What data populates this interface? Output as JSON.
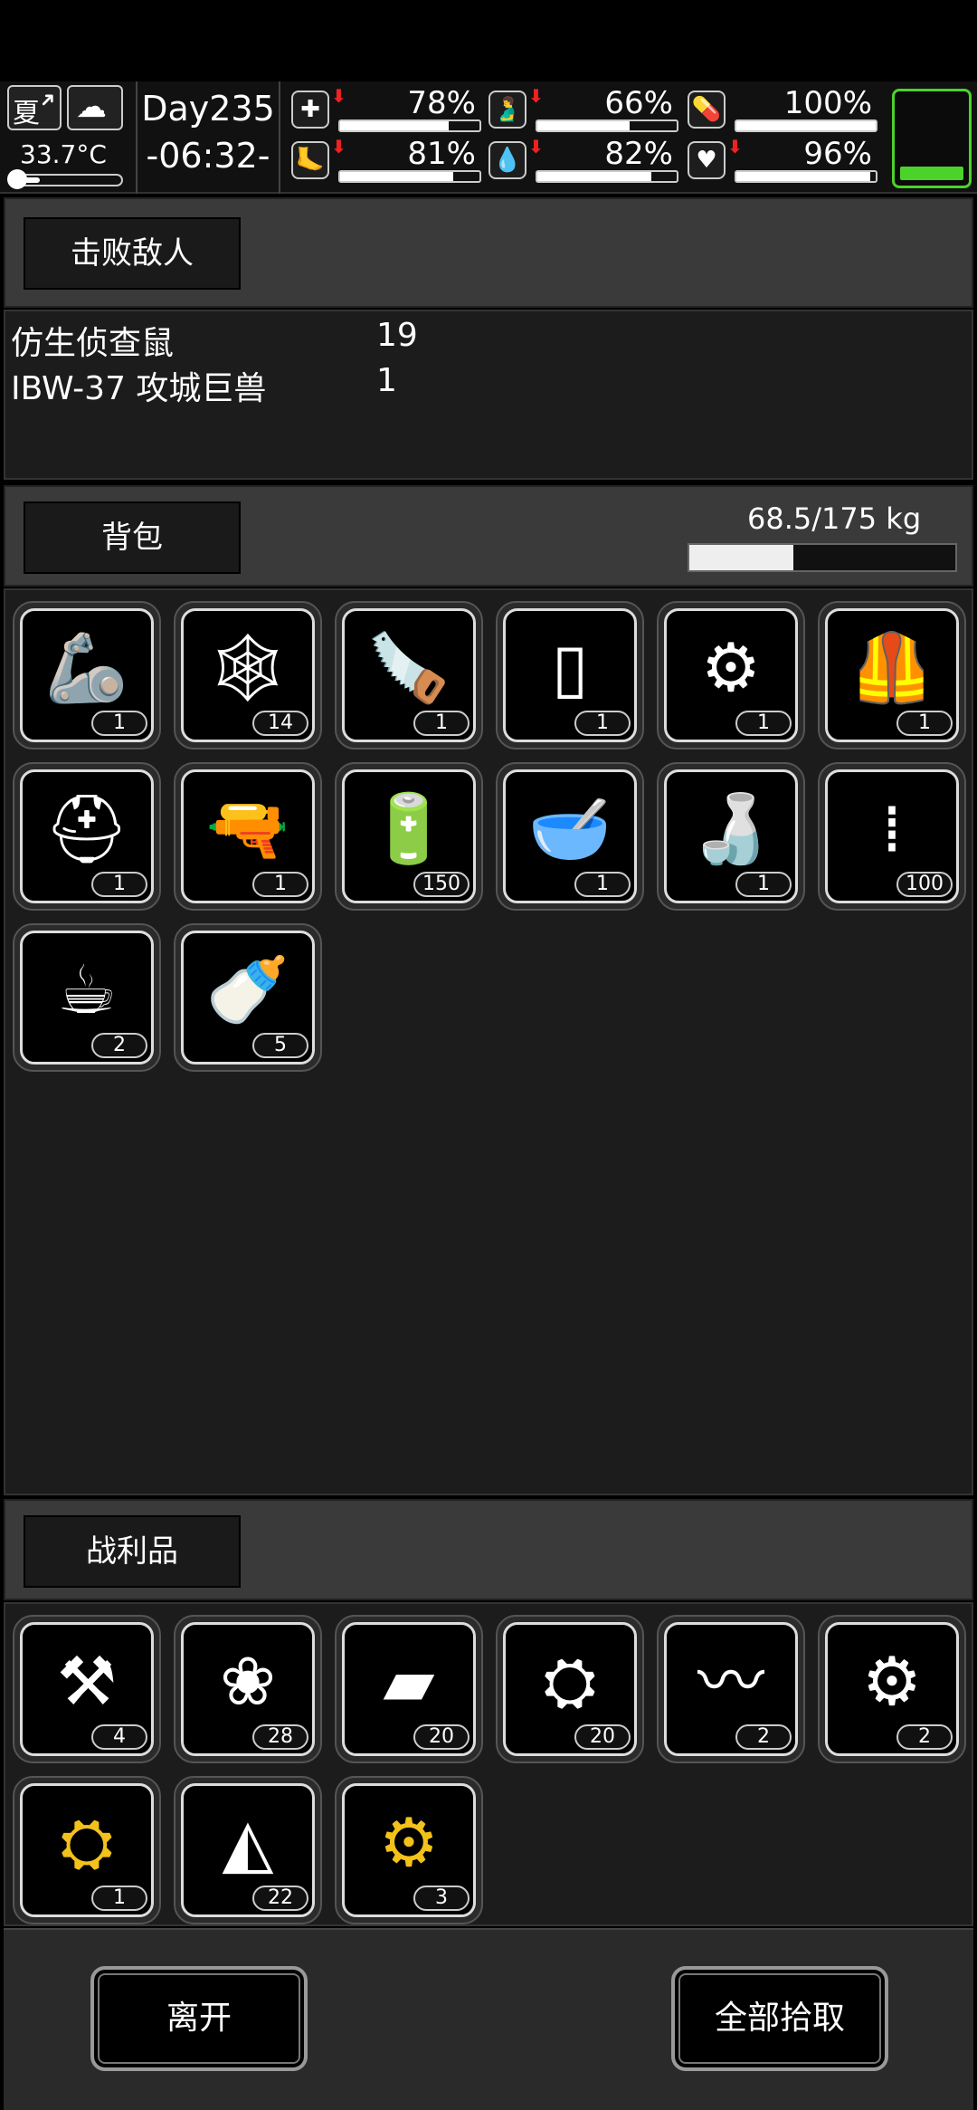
{
  "status": {
    "season": "夏",
    "season_arrow_icon": "up-right-arrow",
    "weather_icon": "rain-cloud",
    "temperature": "33.7°C",
    "day": "Day235",
    "time": "-06:32-",
    "stats": [
      {
        "icon": "medkit-icon",
        "glyph": "✚",
        "percent": "78%",
        "value": 0.78,
        "trend": "down"
      },
      {
        "icon": "stomach-icon",
        "glyph": "🫃",
        "percent": "66%",
        "value": 0.66,
        "trend": "down"
      },
      {
        "icon": "pill-icon",
        "glyph": "💊",
        "percent": "100%",
        "value": 1.0,
        "trend": "none"
      },
      {
        "icon": "foot-icon",
        "glyph": "🦶",
        "percent": "81%",
        "value": 0.81,
        "trend": "down"
      },
      {
        "icon": "water-drop-icon",
        "glyph": "💧",
        "percent": "82%",
        "value": 0.82,
        "trend": "down"
      },
      {
        "icon": "heart-icon",
        "glyph": "♥",
        "percent": "96%",
        "value": 0.96,
        "trend": "down"
      }
    ],
    "battery_level": 0.15,
    "accent_green": "#4bd32a"
  },
  "defeated": {
    "title": "击败敌人",
    "enemies": [
      {
        "name": "仿生侦查鼠",
        "count": "19"
      },
      {
        "name": "IBW-37 攻城巨兽",
        "count": "1"
      }
    ]
  },
  "backpack": {
    "title": "背包",
    "weight": "68.5/175 kg",
    "weight_fraction": 0.39,
    "items": [
      {
        "icon": "robotic-arm-icon",
        "glyph": "🦾",
        "color": "white",
        "count": "1"
      },
      {
        "icon": "net-icon",
        "glyph": "🕸",
        "color": "white",
        "count": "14"
      },
      {
        "icon": "chainsaw-weapon-icon",
        "glyph": "🪚",
        "color": "orange",
        "count": "1"
      },
      {
        "icon": "canister-icon",
        "glyph": "▯",
        "color": "white",
        "count": "1"
      },
      {
        "icon": "scrap-parts-icon",
        "glyph": "⚙",
        "color": "white",
        "count": "1"
      },
      {
        "icon": "armor-vest-icon",
        "glyph": "🦺",
        "color": "white",
        "count": "1"
      },
      {
        "icon": "helmet-icon",
        "glyph": "⛑",
        "color": "white",
        "count": "1"
      },
      {
        "icon": "minigun-icon",
        "glyph": "🔫",
        "color": "blue",
        "count": "1"
      },
      {
        "icon": "battery-icon",
        "glyph": "🔋",
        "color": "white",
        "count": "150"
      },
      {
        "icon": "food-bowl-icon",
        "glyph": "🥣",
        "color": "white",
        "count": "1"
      },
      {
        "icon": "water-bottle-icon",
        "glyph": "🍶",
        "color": "white",
        "count": "1"
      },
      {
        "icon": "bullets-icon",
        "glyph": "⁞",
        "color": "white",
        "count": "100"
      },
      {
        "icon": "coffee-cup-icon",
        "glyph": "☕",
        "color": "white",
        "count": "2"
      },
      {
        "icon": "milk-bottle-icon",
        "glyph": "🍼",
        "color": "white",
        "count": "5"
      }
    ]
  },
  "loot": {
    "title": "战利品",
    "items": [
      {
        "icon": "metal-scrap-icon",
        "glyph": "⚒",
        "color": "white",
        "count": "4"
      },
      {
        "icon": "cotton-balls-icon",
        "glyph": "❀",
        "color": "white",
        "count": "28"
      },
      {
        "icon": "metal-plate-icon",
        "glyph": "▰",
        "color": "white",
        "count": "20"
      },
      {
        "icon": "mechanical-parts-icon",
        "glyph": "⛭",
        "color": "white",
        "count": "20"
      },
      {
        "icon": "wires-icon",
        "glyph": "〰",
        "color": "white",
        "count": "2"
      },
      {
        "icon": "gears-icon",
        "glyph": "⚙",
        "color": "white",
        "count": "2"
      },
      {
        "icon": "gold-mechanical-parts-icon",
        "glyph": "⛭",
        "color": "gold",
        "count": "1"
      },
      {
        "icon": "cloth-icon",
        "glyph": "◭",
        "color": "white",
        "count": "22"
      },
      {
        "icon": "gold-gears-icon",
        "glyph": "⚙",
        "color": "gold",
        "count": "3"
      }
    ]
  },
  "buttons": {
    "leave": "离开",
    "take_all": "全部拾取"
  }
}
